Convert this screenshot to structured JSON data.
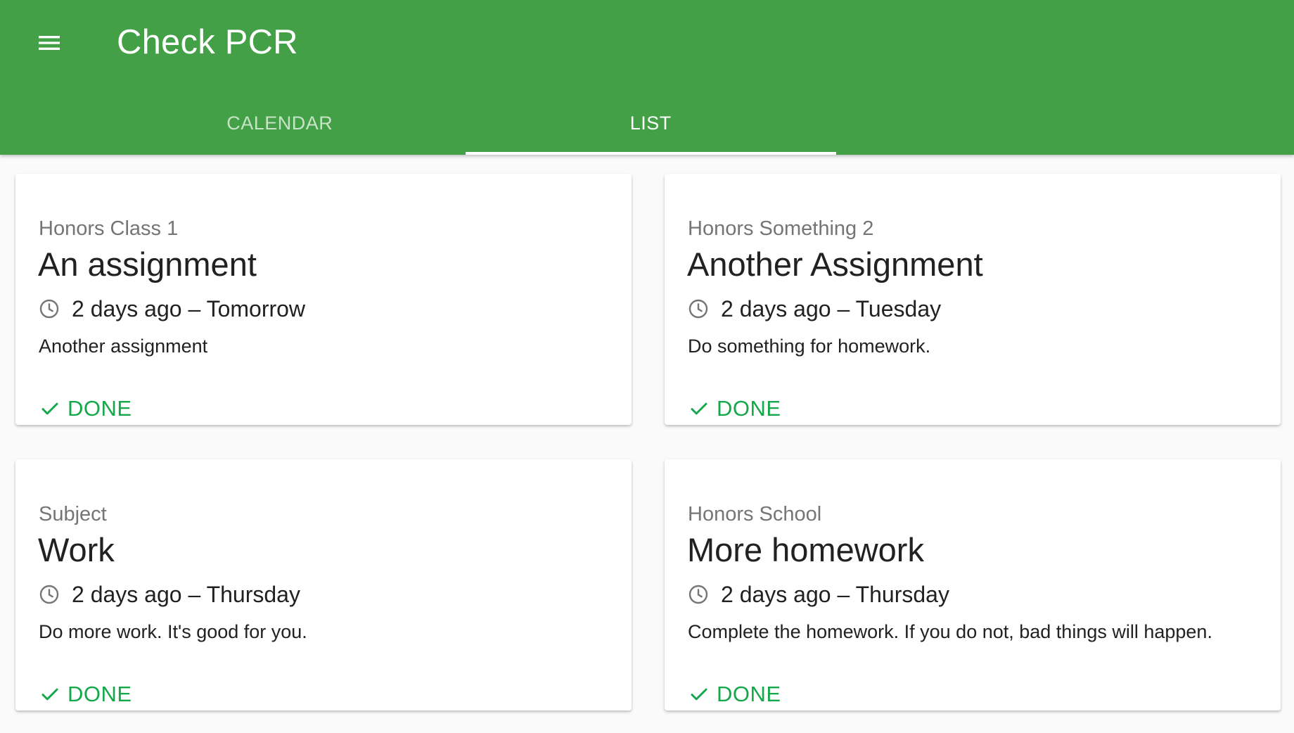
{
  "app": {
    "title": "Check PCR",
    "accent_color": "#43a047",
    "action_color": "#14a84a"
  },
  "tabs": [
    {
      "label": "CALENDAR",
      "active": false
    },
    {
      "label": "LIST",
      "active": true
    }
  ],
  "cards": [
    {
      "subject": "Honors Class 1",
      "title": "An assignment",
      "time": "2 days ago – Tomorrow",
      "description": "Another assignment",
      "action_label": "DONE",
      "action_icon": "check-icon",
      "time_icon": "clock-icon"
    },
    {
      "subject": "Honors Something 2",
      "title": "Another Assignment",
      "time": "2 days ago – Tuesday",
      "description": "Do something for homework.",
      "action_label": "DONE",
      "action_icon": "check-icon",
      "time_icon": "clock-icon"
    },
    {
      "subject": "Subject",
      "title": "Work",
      "time": "2 days ago – Thursday",
      "description": "Do more work. It's good for you.",
      "action_label": "DONE",
      "action_icon": "check-icon",
      "time_icon": "clock-icon"
    },
    {
      "subject": "Honors School",
      "title": "More homework",
      "time": "2 days ago – Thursday",
      "description": "Complete the homework. If you do not, bad things will happen.",
      "action_label": "DONE",
      "action_icon": "check-icon",
      "time_icon": "clock-icon"
    }
  ]
}
